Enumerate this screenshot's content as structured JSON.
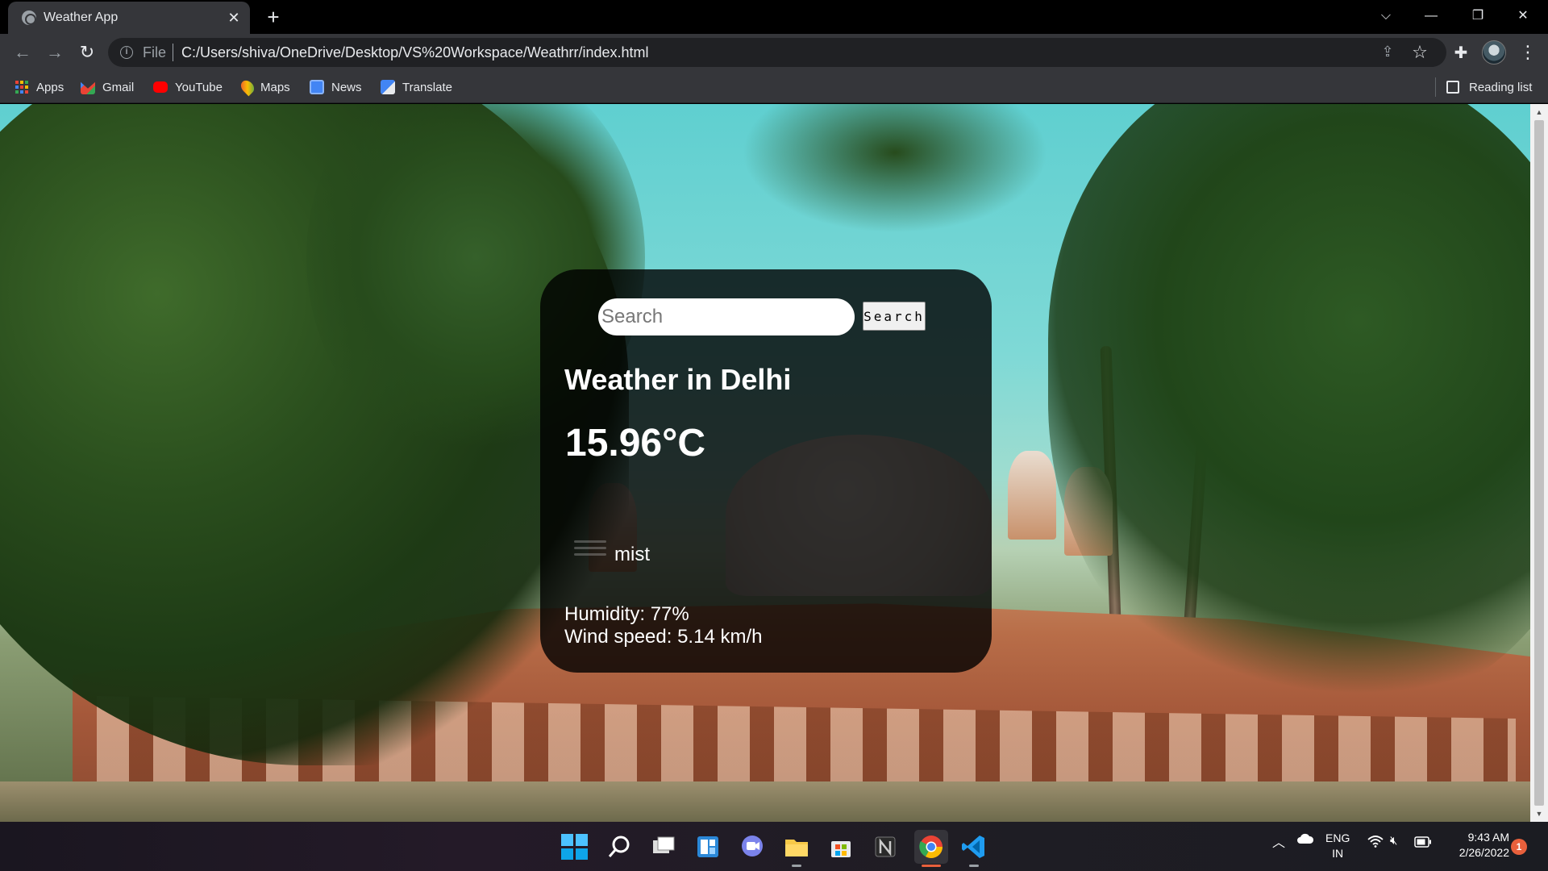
{
  "browser": {
    "tab_title": "Weather App",
    "tab_close_icon": "close-icon",
    "new_tab_icon": "plus-icon",
    "scheme_label": "File",
    "url": "C:/Users/shiva/OneDrive/Desktop/VS%20Workspace/Weathrr/index.html",
    "bookmarks": [
      {
        "label": "Apps",
        "icon": "apps-grid-icon"
      },
      {
        "label": "Gmail",
        "icon": "gmail-icon"
      },
      {
        "label": "YouTube",
        "icon": "youtube-icon"
      },
      {
        "label": "Maps",
        "icon": "maps-icon"
      },
      {
        "label": "News",
        "icon": "news-icon"
      },
      {
        "label": "Translate",
        "icon": "translate-icon"
      }
    ],
    "reading_list_label": "Reading list"
  },
  "weather": {
    "search_placeholder": "Search",
    "search_button_label": "Search",
    "city_heading": "Weather in Delhi",
    "temperature": "15.96°C",
    "description": "mist",
    "humidity": "Humidity: 77%",
    "wind_speed": "Wind speed: 5.14 km/h"
  },
  "taskbar": {
    "apps": [
      "start-icon",
      "search-icon",
      "task-view-icon",
      "widgets-icon",
      "chat-icon",
      "file-explorer-icon",
      "store-icon",
      "notion-icon",
      "chrome-icon",
      "vscode-icon"
    ],
    "language_line1": "ENG",
    "language_line2": "IN",
    "time": "9:43 AM",
    "date": "2/26/2022",
    "notification_count": "1"
  },
  "colors": {
    "browser_chrome": "#35363a",
    "titlebar": "#000000",
    "card_background": "rgba(0,0,0,0.8)",
    "notification_badge": "#e8603c"
  }
}
